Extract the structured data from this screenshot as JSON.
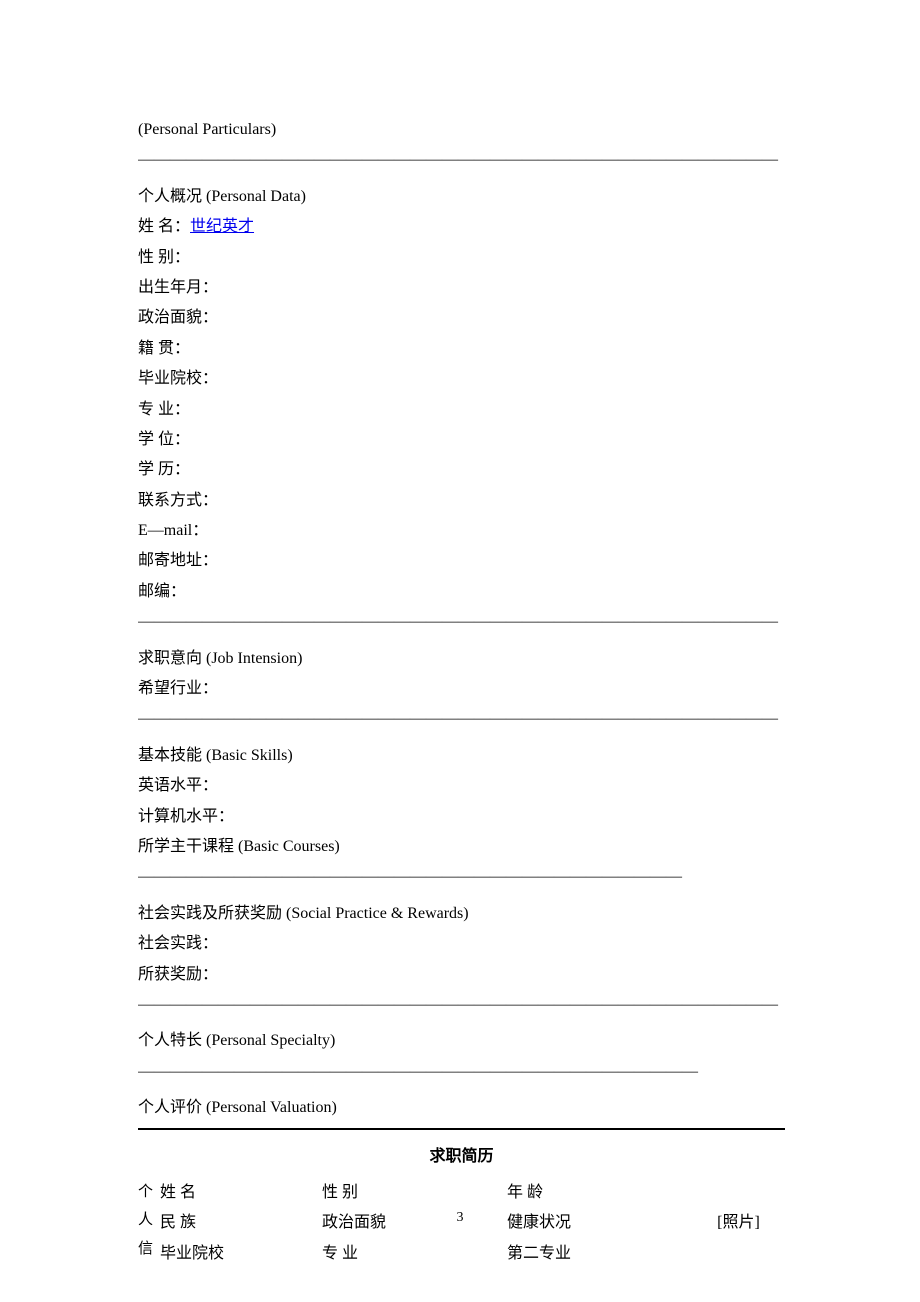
{
  "header": {
    "title": "(Personal Particulars)"
  },
  "divider_long": "————————————————————————————————————————",
  "divider_med1": "——————————————————————————————————",
  "divider_med2": "———————————————————————————————————",
  "section1": {
    "title": "个人概况 (Personal Data)",
    "name_label": "姓 名：",
    "name_link": "世纪英才",
    "gender": "性 别：",
    "birth": "出生年月：",
    "political": "政治面貌：",
    "origin": "籍 贯：",
    "school": "毕业院校：",
    "major": "专 业：",
    "degree": "学 位：",
    "education": "学 历：",
    "contact": "联系方式：",
    "email": "E—mail：",
    "mail_addr": "邮寄地址：",
    "postcode": "邮编："
  },
  "section2": {
    "title": "求职意向 (Job Intension)",
    "industry": "希望行业："
  },
  "section3": {
    "title": "基本技能 (Basic Skills)",
    "english": "英语水平：",
    "computer": "计算机水平：",
    "courses": "所学主干课程 (Basic Courses)"
  },
  "section4": {
    "title": "社会实践及所获奖励 (Social Practice & Rewards)",
    "practice": "社会实践：",
    "rewards": "所获奖励："
  },
  "section5": {
    "title": "个人特长 (Personal Specialty)"
  },
  "section6": {
    "title": "个人评价 (Personal Valuation)"
  },
  "resume2": {
    "title": "求职简历",
    "side": {
      "l1": "个",
      "l2": "人",
      "l3": "信"
    },
    "row1": {
      "c1": "姓 名",
      "c2": "性 别",
      "c3": "年 龄"
    },
    "row2": {
      "c1": "民 族",
      "c2": "政治面貌",
      "c3": "健康状况"
    },
    "row3": {
      "c1": "毕业院校",
      "c2": "专 业",
      "c3": "第二专业"
    },
    "photo": "[照片]"
  },
  "page_num": "3"
}
